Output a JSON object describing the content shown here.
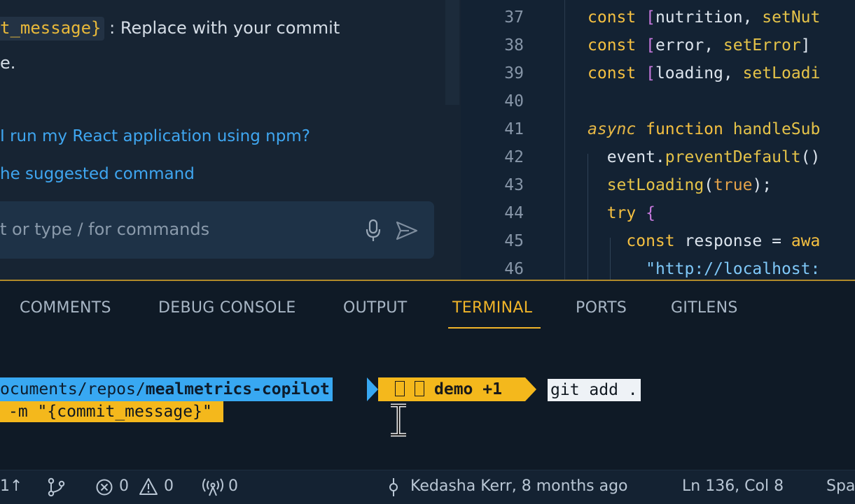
{
  "chat": {
    "line1_chip": "t_message}",
    "line1_text": " : Replace with your commit",
    "line2_text": "e.",
    "suggestion_1": "I run my React application using npm?",
    "suggestion_2": "he suggested command",
    "input_placeholder": "t or type / for commands",
    "mic_icon": "microphone-icon",
    "send_icon": "send-icon"
  },
  "editor": {
    "lines": [
      {
        "no": "37",
        "parts": [
          [
            "kw",
            "const "
          ],
          [
            "br",
            "["
          ],
          [
            "",
            "nutrition, "
          ],
          [
            "fn",
            "setNut"
          ]
        ]
      },
      {
        "no": "38",
        "parts": [
          [
            "kw",
            "const "
          ],
          [
            "br",
            "["
          ],
          [
            "",
            "error, "
          ],
          [
            "fn",
            "setError"
          ],
          [
            "",
            "] "
          ]
        ]
      },
      {
        "no": "39",
        "parts": [
          [
            "kw",
            "const "
          ],
          [
            "br",
            "["
          ],
          [
            "",
            "loading, "
          ],
          [
            "fn",
            "setLoadi"
          ]
        ]
      },
      {
        "no": "40",
        "parts": []
      },
      {
        "no": "41",
        "parts": [
          [
            "kwi",
            "async "
          ],
          [
            "kw",
            "function "
          ],
          [
            "fn",
            "handleSub"
          ]
        ]
      },
      {
        "no": "42",
        "parts": [
          [
            "",
            "  event."
          ],
          [
            "fn",
            "preventDefault"
          ],
          [
            "",
            "()"
          ]
        ]
      },
      {
        "no": "43",
        "parts": [
          [
            "",
            "  "
          ],
          [
            "fn",
            "setLoading"
          ],
          [
            "",
            "("
          ],
          [
            "bool",
            "true"
          ],
          [
            "",
            ");"
          ]
        ]
      },
      {
        "no": "44",
        "parts": [
          [
            "",
            "  "
          ],
          [
            "kw",
            "try "
          ],
          [
            "br",
            "{"
          ]
        ]
      },
      {
        "no": "45",
        "parts": [
          [
            "",
            "    "
          ],
          [
            "kw",
            "const "
          ],
          [
            "",
            "response = "
          ],
          [
            "kw",
            "awa"
          ]
        ]
      },
      {
        "no": "46",
        "parts": [
          [
            "",
            "      "
          ],
          [
            "str",
            "\"http://localhost:"
          ]
        ]
      }
    ]
  },
  "panel": {
    "tabs": [
      {
        "label": "COMMENTS",
        "active": false
      },
      {
        "label": "DEBUG CONSOLE",
        "active": false
      },
      {
        "label": "OUTPUT",
        "active": false
      },
      {
        "label": "TERMINAL",
        "active": true
      },
      {
        "label": "PORTS",
        "active": false
      },
      {
        "label": "GITLENS",
        "active": false
      }
    ]
  },
  "terminal": {
    "path_prefix": "ocuments/repos/",
    "path_repo": "mealmetrics-copilot",
    "branch": "demo +1",
    "command_1": "git add .",
    "command_2_pre": "-m ",
    "command_2_msg": "\"{commit_message}\""
  },
  "status_bar": {
    "sync": "1↑",
    "errors": "0",
    "warnings": "0",
    "ports": "0",
    "blame": "Kedasha Kerr, 8 months ago",
    "cursor": "Ln 136, Col 8",
    "spaces": "Spa"
  },
  "colors": {
    "accent": "#f0b429",
    "link": "#3fa6f0",
    "path_segment": "#38a8f2",
    "git_segment": "#f4b81c"
  }
}
